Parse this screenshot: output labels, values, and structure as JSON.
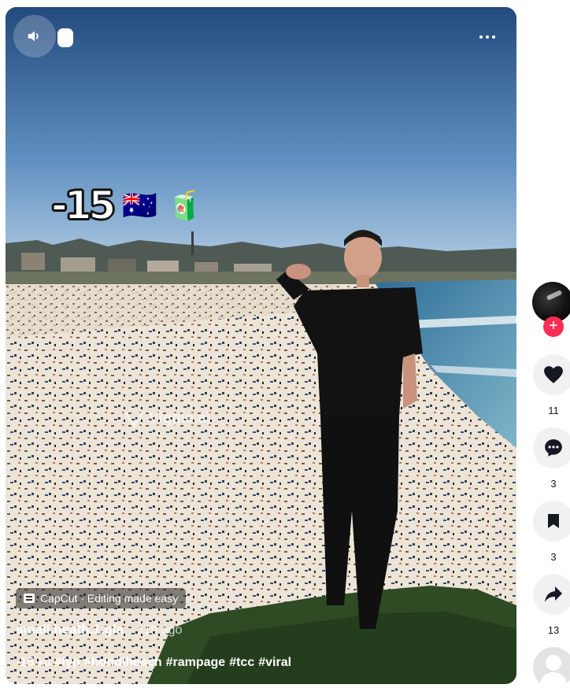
{
  "video": {
    "overlay": {
      "number": "-15",
      "flag_emoji": "🇦🇺",
      "drink_emoji": "🧃"
    },
    "watermark": "Viggle.ai",
    "capcut_label": "CapCut · Editing made easy",
    "author": "small.heath.1.gla",
    "time_ago": "· 11h ago",
    "caption": {
      "number": "-15",
      "au": "AU",
      "tags": [
        "#fyp",
        "#bondibeach",
        "#rampage",
        "#tcc",
        "#viral"
      ]
    }
  },
  "actions": {
    "likes": "11",
    "comments": "3",
    "saves": "3",
    "shares": "13"
  },
  "colors": {
    "follow": "#fe2c55",
    "rail_bg": "#f1f1f2",
    "count_text": "#161823"
  },
  "icons": [
    "speaker-icon",
    "more-icon",
    "heart-icon",
    "comment-icon",
    "bookmark-icon",
    "share-icon",
    "plus-icon"
  ]
}
